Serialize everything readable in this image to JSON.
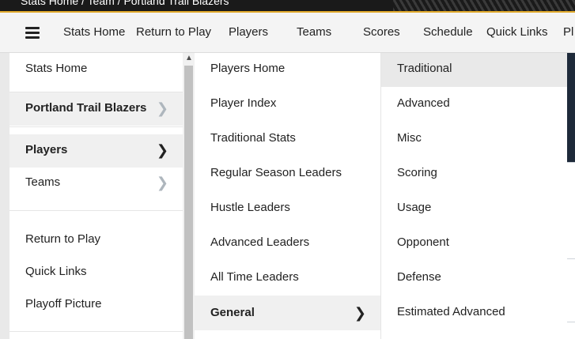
{
  "banner": {
    "breadcrumb": "Stats Home / Team / Portland Trail Blazers"
  },
  "nav": {
    "items": [
      "Stats Home",
      "Return to Play",
      "Players",
      "Teams",
      "Scores",
      "Schedule",
      "Quick Links",
      "Pl"
    ]
  },
  "menu_col1": {
    "items": [
      "Stats Home",
      "Portland Trail Blazers",
      "Players",
      "Teams",
      "Return to Play",
      "Quick Links",
      "Playoff Picture"
    ]
  },
  "menu_col2": {
    "items": [
      "Players Home",
      "Player Index",
      "Traditional Stats",
      "Regular Season Leaders",
      "Hustle Leaders",
      "Advanced Leaders",
      "All Time Leaders",
      "General"
    ]
  },
  "menu_col3": {
    "items": [
      "Traditional",
      "Advanced",
      "Misc",
      "Scoring",
      "Usage",
      "Opponent",
      "Defense",
      "Estimated Advanced"
    ]
  },
  "colors": {
    "accent": "#e0a92b",
    "banner_bg": "#1a1a1a",
    "highlight": "#f0f0f0"
  }
}
